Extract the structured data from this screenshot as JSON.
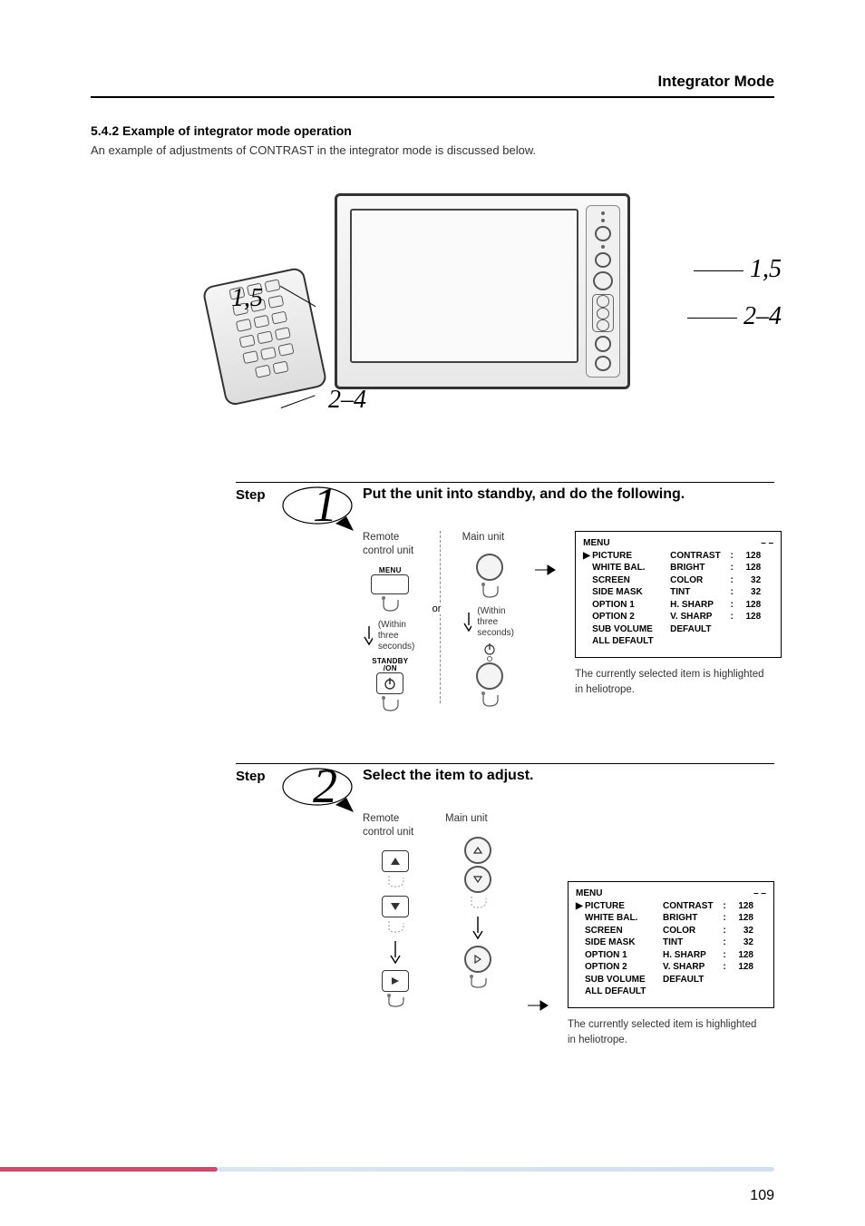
{
  "header": {
    "title": "Integrator Mode"
  },
  "section_heading": "5.4.2 Example of integrator mode operation",
  "intro": "An example of adjustments of CONTRAST in the integrator mode is discussed below.",
  "hero": {
    "remote_callout_top": "1,5",
    "remote_callout_bottom": "2–4",
    "tv_callout_top": "1,5",
    "tv_callout_bottom": "2–4"
  },
  "step1": {
    "label": "Step",
    "number": "1",
    "title": "Put the unit into standby, and do the following.",
    "remote_label": "Remote\ncontrol unit",
    "main_label": "Main unit",
    "menu_btn_label": "MENU",
    "standby_label": "STANDBY\n/ON",
    "within": "(Within three\nseconds)",
    "or": "or",
    "caption": "The currently selected item is highlighted in heliotrope."
  },
  "step2": {
    "label": "Step",
    "number": "2",
    "title": "Select the item to adjust.",
    "remote_label": "Remote\ncontrol unit",
    "main_label": "Main unit",
    "caption": "The currently selected item is highlighted in heliotrope."
  },
  "menu": {
    "title": "MENU",
    "dashes": "– –",
    "left_items": [
      "PICTURE",
      "WHITE BAL.",
      "SCREEN",
      "SIDE MASK",
      "OPTION 1",
      "OPTION 2",
      "SUB VOLUME",
      "ALL DEFAULT"
    ],
    "right_rows": [
      {
        "label": "CONTRAST",
        "colon": ":",
        "val": "128"
      },
      {
        "label": "BRIGHT",
        "colon": ":",
        "val": "128"
      },
      {
        "label": "COLOR",
        "colon": ":",
        "val": "32"
      },
      {
        "label": "TINT",
        "colon": ":",
        "val": "32"
      },
      {
        "label": "H. SHARP",
        "colon": ":",
        "val": "128"
      },
      {
        "label": "V. SHARP",
        "colon": ":",
        "val": "128"
      },
      {
        "label": "DEFAULT",
        "colon": "",
        "val": ""
      }
    ]
  },
  "page_number": "109"
}
